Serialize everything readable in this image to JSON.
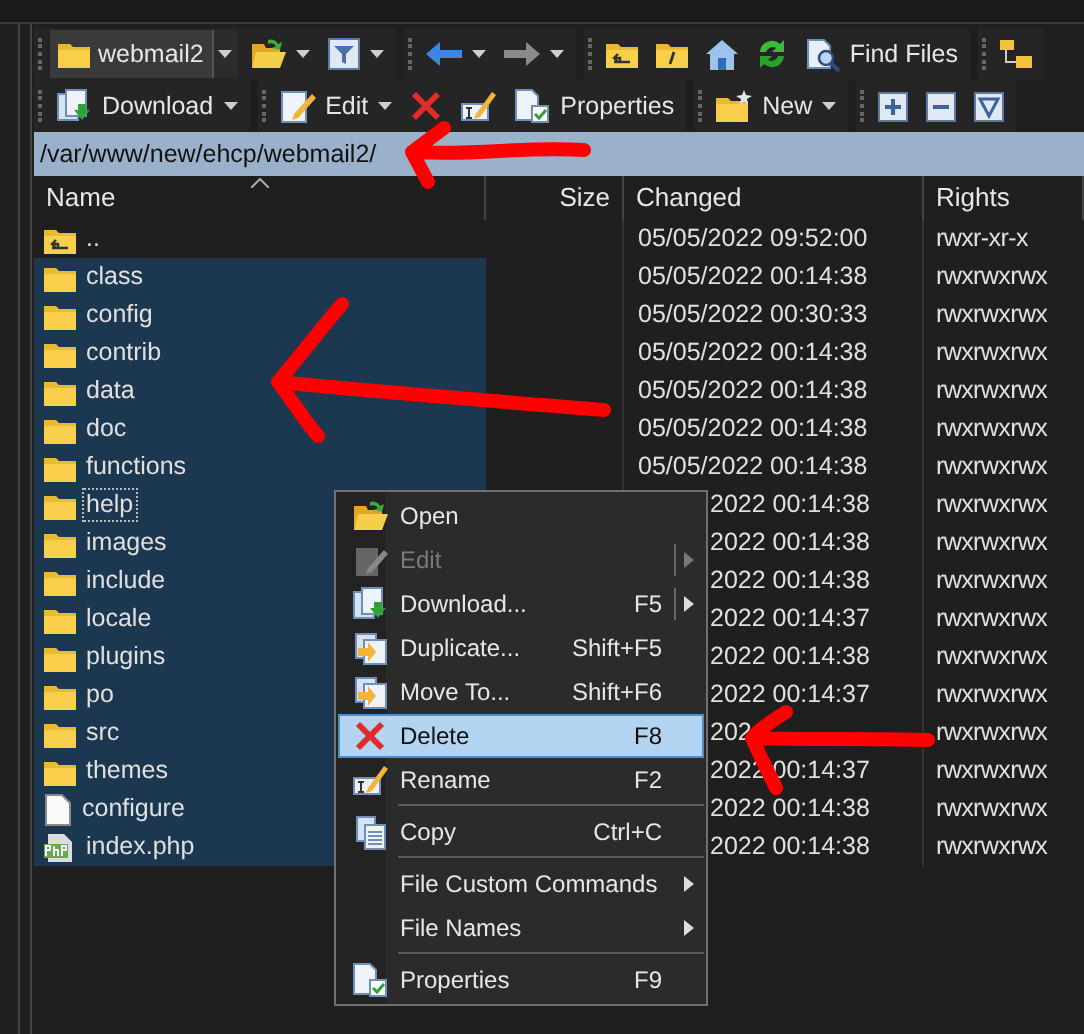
{
  "toolbar_1": [
    {
      "items": [
        {
          "kind": "drive",
          "label": "webmail2",
          "dropdown": true
        },
        {
          "kind": "open",
          "dropdown": true
        },
        {
          "kind": "filter",
          "dropdown": true
        }
      ]
    },
    {
      "items": [
        {
          "kind": "back",
          "dropdown": true
        },
        {
          "kind": "forward",
          "dropdown": true
        }
      ]
    },
    {
      "items": [
        {
          "kind": "parent",
          "dropdown": false
        },
        {
          "kind": "root",
          "dropdown": false
        },
        {
          "kind": "home",
          "dropdown": false
        },
        {
          "kind": "refresh",
          "dropdown": false
        },
        {
          "kind": "find",
          "label": "Find Files",
          "dropdown": false
        }
      ]
    },
    {
      "items": [
        {
          "kind": "tree",
          "dropdown": false
        }
      ]
    }
  ],
  "toolbar_2": [
    {
      "items": [
        {
          "kind": "download",
          "label": "Download",
          "dropdown": true
        }
      ]
    },
    {
      "items": [
        {
          "kind": "edit",
          "label": "Edit",
          "dropdown": true
        },
        {
          "kind": "delete",
          "dropdown": false
        },
        {
          "kind": "rename",
          "dropdown": false
        },
        {
          "kind": "properties",
          "label": "Properties",
          "dropdown": false
        }
      ]
    },
    {
      "items": [
        {
          "kind": "new",
          "label": "New",
          "dropdown": true
        }
      ]
    },
    {
      "items": [
        {
          "kind": "plus",
          "dropdown": false
        },
        {
          "kind": "minus",
          "dropdown": false
        },
        {
          "kind": "select",
          "dropdown": false
        }
      ]
    }
  ],
  "path": "/var/www/new/ehcp/webmail2/",
  "columns": [
    {
      "label": "Name",
      "sorted": true
    },
    {
      "label": "Size",
      "sorted": false
    },
    {
      "label": "Changed",
      "sorted": false
    },
    {
      "label": "Rights",
      "sorted": false
    }
  ],
  "rows": [
    {
      "kind": "parent",
      "name": "..",
      "changed": "05/05/2022 09:52:00",
      "rights": "rwxr-xr-x",
      "selected": false,
      "focused": false,
      "under_menu": false
    },
    {
      "kind": "folder",
      "name": "class",
      "changed": "05/05/2022 00:14:38",
      "rights": "rwxrwxrwx",
      "selected": true,
      "focused": false,
      "under_menu": false
    },
    {
      "kind": "folder",
      "name": "config",
      "changed": "05/05/2022 00:30:33",
      "rights": "rwxrwxrwx",
      "selected": true,
      "focused": false,
      "under_menu": false
    },
    {
      "kind": "folder",
      "name": "contrib",
      "changed": "05/05/2022 00:14:38",
      "rights": "rwxrwxrwx",
      "selected": true,
      "focused": false,
      "under_menu": false
    },
    {
      "kind": "folder",
      "name": "data",
      "changed": "05/05/2022 00:14:38",
      "rights": "rwxrwxrwx",
      "selected": true,
      "focused": false,
      "under_menu": false
    },
    {
      "kind": "folder",
      "name": "doc",
      "changed": "05/05/2022 00:14:38",
      "rights": "rwxrwxrwx",
      "selected": true,
      "focused": false,
      "under_menu": false
    },
    {
      "kind": "folder",
      "name": "functions",
      "changed": "05/05/2022 00:14:38",
      "rights": "rwxrwxrwx",
      "selected": true,
      "focused": false,
      "under_menu": false
    },
    {
      "kind": "folder",
      "name": "help",
      "changed": "2022 00:14:38",
      "rights": "rwxrwxrwx",
      "selected": true,
      "focused": true,
      "under_menu": true
    },
    {
      "kind": "folder",
      "name": "images",
      "changed": "2022 00:14:38",
      "rights": "rwxrwxrwx",
      "selected": true,
      "focused": false,
      "under_menu": true
    },
    {
      "kind": "folder",
      "name": "include",
      "changed": "2022 00:14:38",
      "rights": "rwxrwxrwx",
      "selected": true,
      "focused": false,
      "under_menu": true
    },
    {
      "kind": "folder",
      "name": "locale",
      "changed": "2022 00:14:37",
      "rights": "rwxrwxrwx",
      "selected": true,
      "focused": false,
      "under_menu": true
    },
    {
      "kind": "folder",
      "name": "plugins",
      "changed": "2022 00:14:38",
      "rights": "rwxrwxrwx",
      "selected": true,
      "focused": false,
      "under_menu": true
    },
    {
      "kind": "folder",
      "name": "po",
      "changed": "2022 00:14:37",
      "rights": "rwxrwxrwx",
      "selected": true,
      "focused": false,
      "under_menu": true
    },
    {
      "kind": "folder",
      "name": "src",
      "changed": "202",
      "rights": "rwxrwxrwx",
      "selected": true,
      "focused": false,
      "under_menu": true
    },
    {
      "kind": "folder",
      "name": "themes",
      "changed": "2022 00:14:37",
      "rights": "rwxrwxrwx",
      "selected": true,
      "focused": false,
      "under_menu": true
    },
    {
      "kind": "file",
      "name": "configure",
      "changed": "2022 00:14:38",
      "rights": "rwxrwxrwx",
      "selected": true,
      "focused": false,
      "under_menu": true
    },
    {
      "kind": "php",
      "name": "index.php",
      "changed": "2022 00:14:38",
      "rights": "rwxrwxrwx",
      "selected": true,
      "focused": false,
      "under_menu": true
    }
  ],
  "context_menu": [
    {
      "kind": "open",
      "label": "Open",
      "disabled": false,
      "selected": false,
      "submenu": false,
      "split": false
    },
    {
      "kind": "edit",
      "label": "Edit",
      "disabled": true,
      "selected": false,
      "submenu": true,
      "split": true
    },
    {
      "kind": "download",
      "label": "Download...",
      "shortcut": "F5",
      "disabled": false,
      "selected": false,
      "submenu": true,
      "split": true
    },
    {
      "kind": "duplicate",
      "label": "Duplicate...",
      "shortcut": "Shift+F5",
      "disabled": false,
      "selected": false,
      "submenu": false,
      "split": false
    },
    {
      "kind": "move",
      "label": "Move To...",
      "shortcut": "Shift+F6",
      "disabled": false,
      "selected": false,
      "submenu": false,
      "split": false
    },
    {
      "kind": "delete",
      "label": "Delete",
      "shortcut": "F8",
      "disabled": false,
      "selected": true,
      "submenu": false,
      "split": false
    },
    {
      "kind": "rename",
      "label": "Rename",
      "shortcut": "F2",
      "disabled": false,
      "selected": false,
      "submenu": false,
      "split": false
    },
    {
      "kind": "separator"
    },
    {
      "kind": "copy",
      "label": "Copy",
      "shortcut": "Ctrl+C",
      "disabled": false,
      "selected": false,
      "submenu": false,
      "split": false
    },
    {
      "kind": "separator"
    },
    {
      "kind": "plain",
      "label": "File Custom Commands",
      "disabled": false,
      "selected": false,
      "submenu": true,
      "split": false
    },
    {
      "kind": "plain",
      "label": "File Names",
      "disabled": false,
      "selected": false,
      "submenu": true,
      "split": false
    },
    {
      "kind": "separator"
    },
    {
      "kind": "properties",
      "label": "Properties",
      "shortcut": "F9",
      "disabled": false,
      "selected": false,
      "submenu": false,
      "split": false
    }
  ]
}
